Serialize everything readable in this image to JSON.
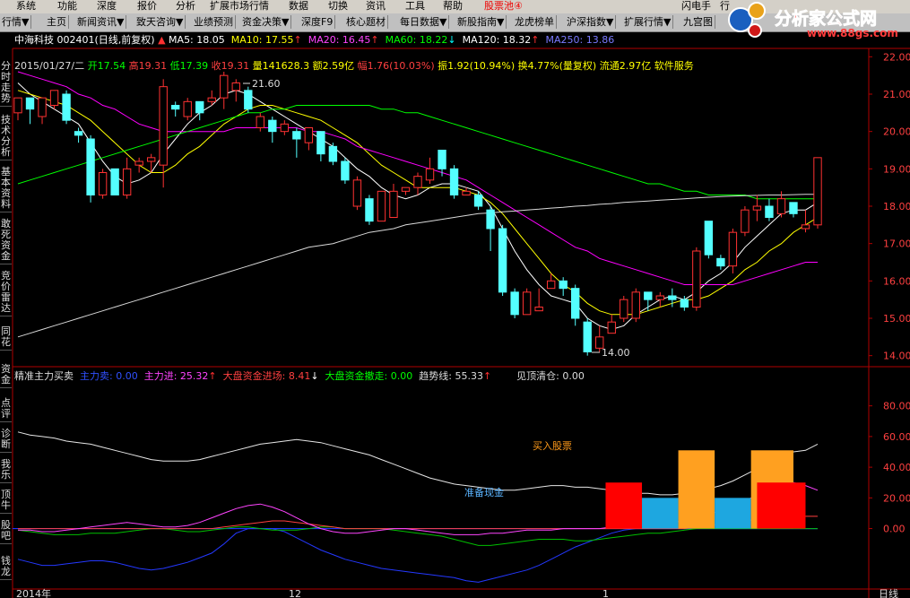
{
  "menu": {
    "items": [
      "系统",
      "功能",
      "深度",
      "报价",
      "分析",
      "扩展市场行情",
      "数据",
      "切换",
      "资讯",
      "工具",
      "帮助"
    ],
    "stock_pool": "股票池④",
    "right_items": [
      "闪电手",
      "行"
    ]
  },
  "toolbar": {
    "items": [
      "行情▼",
      "主页",
      "新闻资讯▼",
      "致天咨询▼",
      "业绩预测",
      "资金决策▼",
      "深度F9",
      "核心题材",
      "每日数据▼",
      "新股指南▼",
      "龙虎榜单",
      "沪深指数▼",
      "扩展行情▼",
      "九宫图"
    ]
  },
  "logo": {
    "text": "分析家公式网",
    "url": "www.88gs.com"
  },
  "sidebar": {
    "items": [
      "分时走势",
      "技术分析",
      "基本资料",
      "敢死资金",
      "竞价雷达",
      "同花",
      "资金",
      "点评",
      "诊断",
      "我乐",
      "顶牛",
      "股吧",
      "钱龙"
    ]
  },
  "stock": {
    "title": "中海科技 002401(日线,前复权)",
    "ma5": "MA5: 18.05",
    "ma10": "MA10: 17.55",
    "ma20": "MA20: 16.45",
    "ma60": "MA60: 18.22",
    "ma120": "MA120: 18.32",
    "ma250": "MA250: 13.86",
    "date": "2015/01/27/二",
    "open": "开17.54",
    "high": "高19.31",
    "low": "低17.39",
    "close": "收19.31",
    "volume": "量141628.3",
    "amount": "额2.59亿",
    "change": "幅1.76(10.03%)",
    "amplitude": "振1.92(10.94%)",
    "turnover": "换4.77%(量复权)",
    "float_cap": "流通2.97亿",
    "industry": "软件服务",
    "max_label": "21.60",
    "min_label": "14.00"
  },
  "indicator": {
    "name": "精准主力买卖",
    "main_sell": "主力卖: 0.00",
    "main_buy": "主力进: 25.32",
    "big_in": "大盘资金进场: 8.41",
    "big_out": "大盘资金撤走: 0.00",
    "trend": "趋势线: 55.33",
    "top_exit": "见顶清仓: 0.00",
    "prepare_cash": "准备现金",
    "buy_stock": "买入股票"
  },
  "price_axis": [
    "22.00",
    "21.00",
    "20.00",
    "19.00",
    "18.00",
    "17.00",
    "16.00",
    "15.00",
    "14.00"
  ],
  "ind_axis": [
    "80.00",
    "60.00",
    "40.00",
    "20.00",
    "0.00"
  ],
  "bottom": {
    "year": "2014年",
    "m12": "12",
    "m1": "1",
    "right": "日线"
  },
  "colors": {
    "up": "#ff3232",
    "down": "#54ffff",
    "ma5": "#ffffff",
    "ma10": "#ffff00",
    "ma20": "#ff00ff",
    "ma60": "#00ff00"
  },
  "chart_data": {
    "type": "candlestick",
    "ylim": [
      13.8,
      22.2
    ],
    "candles": [
      [
        20.5,
        20.9,
        20.3,
        20.8
      ],
      [
        20.9,
        20.6,
        20.2,
        20.9
      ],
      [
        20.4,
        20.9,
        20.2,
        20.6
      ],
      [
        20.7,
        21.1,
        20.6,
        20.9
      ],
      [
        21.0,
        20.3,
        20.2,
        21.1
      ],
      [
        20.0,
        19.9,
        19.7,
        20.1
      ],
      [
        19.8,
        18.3,
        18.1,
        19.9
      ],
      [
        18.3,
        18.9,
        18.2,
        19.0
      ],
      [
        19.0,
        18.3,
        18.3,
        19.0
      ],
      [
        18.3,
        19.0,
        18.2,
        19.3
      ],
      [
        19.1,
        19.2,
        18.9,
        19.3
      ],
      [
        19.2,
        19.3,
        18.9,
        19.4
      ],
      [
        19.1,
        21.2,
        18.5,
        21.4
      ],
      [
        20.7,
        20.6,
        20.4,
        20.8
      ],
      [
        20.4,
        20.8,
        20.3,
        20.9
      ],
      [
        20.8,
        20.5,
        20.3,
        20.8
      ],
      [
        20.8,
        20.9,
        20.7,
        21.1
      ],
      [
        20.9,
        21.5,
        20.6,
        21.6
      ],
      [
        21.1,
        21.3,
        20.8,
        21.4
      ],
      [
        21.1,
        20.6,
        20.5,
        21.2
      ],
      [
        20.1,
        20.4,
        20.0,
        20.5
      ],
      [
        20.3,
        20.0,
        19.7,
        20.4
      ],
      [
        20.0,
        20.2,
        19.9,
        20.3
      ],
      [
        20.0,
        19.8,
        19.3,
        20.1
      ],
      [
        19.7,
        20.1,
        19.5,
        20.1
      ],
      [
        20.0,
        19.4,
        19.2,
        20.0
      ],
      [
        19.6,
        19.2,
        19.1,
        19.7
      ],
      [
        19.2,
        18.7,
        18.6,
        19.3
      ],
      [
        18.0,
        18.7,
        17.9,
        18.8
      ],
      [
        18.2,
        17.6,
        17.5,
        18.3
      ],
      [
        17.6,
        18.4,
        17.6,
        18.4
      ],
      [
        17.7,
        18.4,
        17.7,
        18.6
      ],
      [
        18.4,
        18.5,
        18.3,
        18.5
      ],
      [
        18.5,
        18.8,
        18.3,
        18.9
      ],
      [
        18.7,
        19.0,
        18.6,
        19.3
      ],
      [
        19.5,
        19.0,
        18.8,
        19.5
      ],
      [
        19.0,
        18.3,
        18.2,
        19.1
      ],
      [
        18.3,
        18.4,
        18.3,
        18.5
      ],
      [
        18.3,
        18.0,
        17.9,
        18.4
      ],
      [
        17.9,
        17.4,
        16.8,
        18.0
      ],
      [
        17.4,
        15.7,
        15.6,
        17.5
      ],
      [
        15.7,
        15.1,
        15.0,
        15.8
      ],
      [
        15.1,
        15.7,
        15.2,
        15.8
      ],
      [
        15.2,
        15.3,
        15.2,
        15.8
      ],
      [
        15.8,
        16.0,
        15.8,
        16.2
      ],
      [
        16.0,
        15.8,
        15.6,
        16.1
      ],
      [
        15.8,
        15.0,
        14.8,
        15.9
      ],
      [
        14.9,
        14.1,
        14.0,
        15.0
      ],
      [
        14.2,
        14.5,
        14.1,
        14.8
      ],
      [
        14.6,
        14.9,
        14.6,
        15.1
      ],
      [
        15.0,
        15.5,
        14.9,
        15.6
      ],
      [
        15.0,
        15.7,
        14.9,
        15.8
      ],
      [
        15.7,
        15.5,
        15.2,
        15.7
      ],
      [
        15.5,
        15.6,
        15.3,
        15.7
      ],
      [
        15.6,
        15.5,
        15.3,
        15.8
      ],
      [
        15.5,
        15.3,
        15.2,
        15.6
      ],
      [
        15.3,
        16.8,
        15.2,
        16.9
      ],
      [
        17.6,
        16.7,
        16.6,
        17.6
      ],
      [
        16.6,
        16.4,
        16.3,
        16.7
      ],
      [
        16.4,
        17.3,
        16.2,
        17.4
      ],
      [
        17.3,
        17.9,
        17.2,
        18.0
      ],
      [
        17.9,
        18.0,
        17.6,
        18.3
      ],
      [
        18.0,
        17.7,
        17.6,
        18.2
      ],
      [
        17.8,
        18.2,
        17.7,
        18.4
      ],
      [
        18.1,
        17.8,
        17.7,
        18.1
      ],
      [
        17.4,
        17.5,
        17.3,
        17.9
      ],
      [
        17.5,
        19.3,
        17.4,
        19.3
      ]
    ],
    "series": [
      {
        "name": "MA5",
        "values": [
          21.3,
          21.0,
          20.8,
          20.6,
          20.4,
          20.2,
          19.7,
          19.2,
          18.8,
          18.6,
          18.7,
          18.9,
          19.4,
          19.8,
          20.2,
          20.5,
          20.7,
          21.0,
          21.1,
          21.0,
          20.8,
          20.6,
          20.4,
          20.2,
          20.0,
          19.8,
          19.6,
          19.3,
          19.0,
          18.8,
          18.5,
          18.3,
          18.2,
          18.3,
          18.5,
          18.6,
          18.6,
          18.5,
          18.4,
          18.0,
          17.4,
          16.8,
          16.3,
          15.9,
          15.6,
          15.5,
          15.4,
          15.0,
          14.8,
          14.7,
          14.8,
          15.1,
          15.3,
          15.5,
          15.6,
          15.5,
          15.7,
          16.0,
          16.2,
          16.5,
          16.9,
          17.2,
          17.5,
          17.8,
          17.9,
          17.9,
          18.1
        ]
      },
      {
        "name": "MA10",
        "values": [
          21.1,
          21.0,
          20.9,
          20.8,
          20.7,
          20.5,
          20.3,
          20.0,
          19.7,
          19.4,
          19.1,
          18.9,
          18.9,
          19.1,
          19.4,
          19.6,
          19.9,
          20.2,
          20.4,
          20.6,
          20.7,
          20.7,
          20.6,
          20.5,
          20.4,
          20.3,
          20.1,
          19.9,
          19.7,
          19.4,
          19.1,
          18.9,
          18.7,
          18.5,
          18.5,
          18.5,
          18.5,
          18.4,
          18.3,
          18.1,
          17.8,
          17.4,
          17.0,
          16.6,
          16.2,
          15.9,
          15.7,
          15.4,
          15.2,
          15.1,
          15.1,
          15.1,
          15.2,
          15.3,
          15.4,
          15.5,
          15.5,
          15.6,
          15.8,
          16.0,
          16.3,
          16.5,
          16.8,
          17.0,
          17.3,
          17.5,
          17.7
        ]
      },
      {
        "name": "MA20",
        "values": [
          21.6,
          21.5,
          21.4,
          21.3,
          21.2,
          21.0,
          20.9,
          20.7,
          20.6,
          20.4,
          20.2,
          20.1,
          20.0,
          20.0,
          20.0,
          20.0,
          20.0,
          20.0,
          20.1,
          20.1,
          20.1,
          20.1,
          20.1,
          20.1,
          20.0,
          20.0,
          19.9,
          19.8,
          19.6,
          19.5,
          19.4,
          19.3,
          19.2,
          19.1,
          19.0,
          18.9,
          18.8,
          18.7,
          18.5,
          18.3,
          18.1,
          17.9,
          17.7,
          17.5,
          17.3,
          17.1,
          16.9,
          16.8,
          16.6,
          16.5,
          16.4,
          16.3,
          16.2,
          16.1,
          16.0,
          15.9,
          15.9,
          15.9,
          15.9,
          15.9,
          16.0,
          16.1,
          16.2,
          16.3,
          16.4,
          16.5,
          16.5
        ]
      },
      {
        "name": "MA60",
        "values": [
          18.6,
          18.7,
          18.8,
          18.9,
          19.0,
          19.1,
          19.2,
          19.3,
          19.4,
          19.5,
          19.6,
          19.7,
          19.8,
          19.9,
          20.0,
          20.1,
          20.2,
          20.3,
          20.4,
          20.5,
          20.5,
          20.6,
          20.6,
          20.7,
          20.7,
          20.7,
          20.7,
          20.7,
          20.7,
          20.7,
          20.6,
          20.6,
          20.5,
          20.5,
          20.4,
          20.3,
          20.2,
          20.1,
          20.0,
          19.9,
          19.8,
          19.7,
          19.6,
          19.5,
          19.4,
          19.3,
          19.2,
          19.1,
          19.0,
          18.9,
          18.8,
          18.7,
          18.6,
          18.6,
          18.5,
          18.4,
          18.4,
          18.3,
          18.3,
          18.3,
          18.3,
          18.2,
          18.2,
          18.2,
          18.2,
          18.2,
          18.2
        ]
      },
      {
        "name": "MA120",
        "values": [
          14.5,
          14.6,
          14.7,
          14.8,
          14.9,
          15.0,
          15.1,
          15.2,
          15.3,
          15.4,
          15.5,
          15.6,
          15.7,
          15.8,
          15.9,
          16.0,
          16.1,
          16.2,
          16.3,
          16.4,
          16.5,
          16.6,
          16.7,
          16.8,
          16.9,
          16.95,
          17.0,
          17.1,
          17.2,
          17.3,
          17.35,
          17.4,
          17.5,
          17.55,
          17.6,
          17.65,
          17.7,
          17.75,
          17.8,
          17.82,
          17.85,
          17.87,
          17.9,
          17.92,
          17.95,
          17.97,
          18.0,
          18.02,
          18.05,
          18.07,
          18.1,
          18.12,
          18.14,
          18.16,
          18.18,
          18.2,
          18.22,
          18.24,
          18.26,
          18.27,
          18.28,
          18.29,
          18.3,
          18.3,
          18.31,
          18.32,
          18.32
        ]
      }
    ],
    "indicator": {
      "ylim": [
        -40,
        95
      ],
      "trend": [
        63,
        61,
        60,
        59,
        57,
        56,
        55,
        53,
        51,
        49,
        47,
        45,
        44,
        44,
        44,
        45,
        47,
        49,
        51,
        53,
        55,
        56,
        57,
        58,
        57,
        56,
        54,
        52,
        50,
        48,
        45,
        42,
        39,
        36,
        33,
        31,
        29,
        28,
        27,
        26,
        25,
        25,
        26,
        27,
        28,
        28,
        27,
        27,
        26,
        25,
        24,
        23,
        23,
        22,
        22,
        23,
        24,
        26,
        28,
        31,
        35,
        39,
        43,
        47,
        50,
        51,
        55
      ],
      "main_buy": [
        -1,
        -1,
        -2,
        -2,
        -1,
        0,
        1,
        2,
        3,
        4,
        3,
        2,
        1,
        1,
        2,
        4,
        7,
        10,
        13,
        15,
        16,
        14,
        11,
        7,
        3,
        0,
        -2,
        -3,
        -3,
        -2,
        -1,
        0,
        0,
        -1,
        -2,
        -3,
        -4,
        -4,
        -4,
        -3,
        -3,
        -2,
        -1,
        -1,
        -1,
        0,
        0,
        0,
        0,
        1,
        1,
        2,
        2,
        3,
        4,
        5,
        7,
        9,
        12,
        15,
        18,
        22,
        26,
        29,
        30,
        28,
        25
      ],
      "big_in": [
        0,
        0,
        0,
        0,
        0,
        0,
        0,
        0,
        0,
        0,
        0,
        0,
        0,
        0,
        0,
        0,
        0,
        1,
        2,
        3,
        4,
        5,
        5,
        4,
        3,
        2,
        1,
        0,
        0,
        0,
        0,
        0,
        0,
        0,
        0,
        0,
        0,
        0,
        0,
        0,
        0,
        0,
        0,
        0,
        0,
        0,
        0,
        0,
        0,
        0,
        0,
        0,
        0,
        0,
        0,
        0,
        1,
        2,
        3,
        4,
        5,
        6,
        7,
        8,
        8,
        8,
        8
      ],
      "green": [
        -1,
        -2,
        -3,
        -4,
        -4,
        -4,
        -3,
        -3,
        -3,
        -2,
        -1,
        0,
        0,
        -1,
        -2,
        -2,
        -1,
        0,
        1,
        1,
        0,
        -1,
        -1,
        -1,
        0,
        1,
        1,
        0,
        0,
        0,
        0,
        -1,
        -2,
        -3,
        -4,
        -5,
        -7,
        -9,
        -11,
        -11,
        -10,
        -9,
        -8,
        -7,
        -7,
        -7,
        -8,
        -8,
        -7,
        -6,
        -5,
        -4,
        -3,
        -3,
        -2,
        -1,
        0,
        0,
        0,
        0,
        0,
        0,
        0,
        0,
        0,
        0,
        0
      ],
      "main_sell": [
        -20,
        -22,
        -24,
        -24,
        -23,
        -22,
        -21,
        -21,
        -22,
        -24,
        -26,
        -27,
        -26,
        -24,
        -22,
        -19,
        -16,
        -10,
        -3,
        0,
        0,
        0,
        -2,
        -6,
        -10,
        -14,
        -17,
        -20,
        -22,
        -24,
        -26,
        -27,
        -28,
        -29,
        -30,
        -31,
        -32,
        -34,
        -35,
        -33,
        -31,
        -29,
        -27,
        -24,
        -20,
        -16,
        -12,
        -9,
        -6,
        -3,
        -1,
        0,
        0,
        0,
        0,
        0,
        0,
        0,
        0,
        0,
        0,
        0,
        0,
        0,
        0,
        0,
        0
      ],
      "blocks": [
        {
          "label": "red",
          "x0": 48.5,
          "x1": 51.5,
          "top": 30
        },
        {
          "label": "cyan",
          "x0": 51.5,
          "x1": 54.5,
          "top": 20
        },
        {
          "label": "orange",
          "x0": 54.5,
          "x1": 57.5,
          "top": 51
        },
        {
          "label": "cyan",
          "x0": 57.5,
          "x1": 60.5,
          "top": 20
        },
        {
          "label": "orange",
          "x0": 60.5,
          "x1": 64,
          "top": 51
        },
        {
          "label": "red",
          "x0": 61,
          "x1": 65,
          "top": 30
        }
      ]
    }
  }
}
